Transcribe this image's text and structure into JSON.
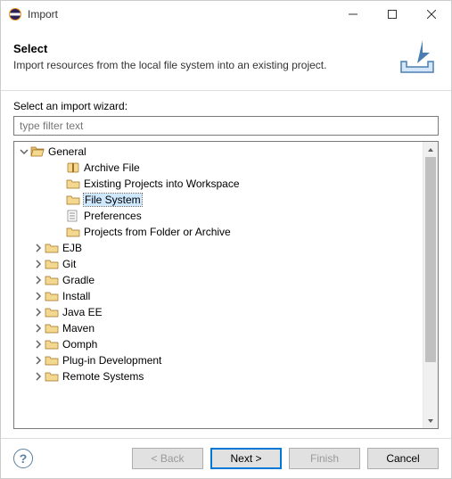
{
  "window": {
    "title": "Import"
  },
  "banner": {
    "title": "Select",
    "description": "Import resources from the local file system into an existing project."
  },
  "wizard": {
    "label": "Select an import wizard:",
    "filter_placeholder": "type filter text"
  },
  "tree": {
    "general": {
      "label": "General",
      "children": {
        "archive": "Archive File",
        "existing": "Existing Projects into Workspace",
        "filesystem": "File System",
        "preferences": "Preferences",
        "projectsfolder": "Projects from Folder or Archive"
      }
    },
    "others": [
      "EJB",
      "Git",
      "Gradle",
      "Install",
      "Java EE",
      "Maven",
      "Oomph",
      "Plug-in Development",
      "Remote Systems"
    ]
  },
  "buttons": {
    "back": "< Back",
    "next": "Next >",
    "finish": "Finish",
    "cancel": "Cancel"
  }
}
